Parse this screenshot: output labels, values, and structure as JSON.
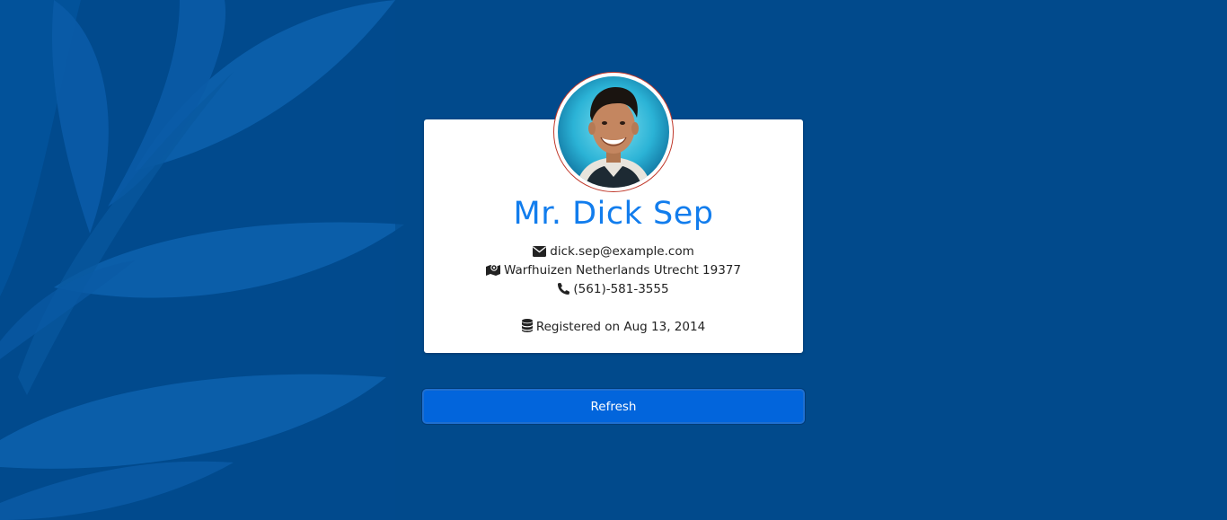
{
  "profile": {
    "name": "Mr. Dick Sep",
    "email": "dick.sep@example.com",
    "address": "Warfhuizen Netherlands Utrecht 19377",
    "phone": "(561)-581-3555",
    "registered": "Registered on Aug 13, 2014",
    "avatar_icon": "profile-photo"
  },
  "actions": {
    "refresh_label": "Refresh"
  },
  "icons": {
    "email": "envelope-icon",
    "address": "map-marked-icon",
    "phone": "phone-icon",
    "registered": "database-icon"
  },
  "colors": {
    "background": "#014a8d",
    "name": "#127ded",
    "button": "#0265dc",
    "avatar_border": "#c0392b"
  }
}
